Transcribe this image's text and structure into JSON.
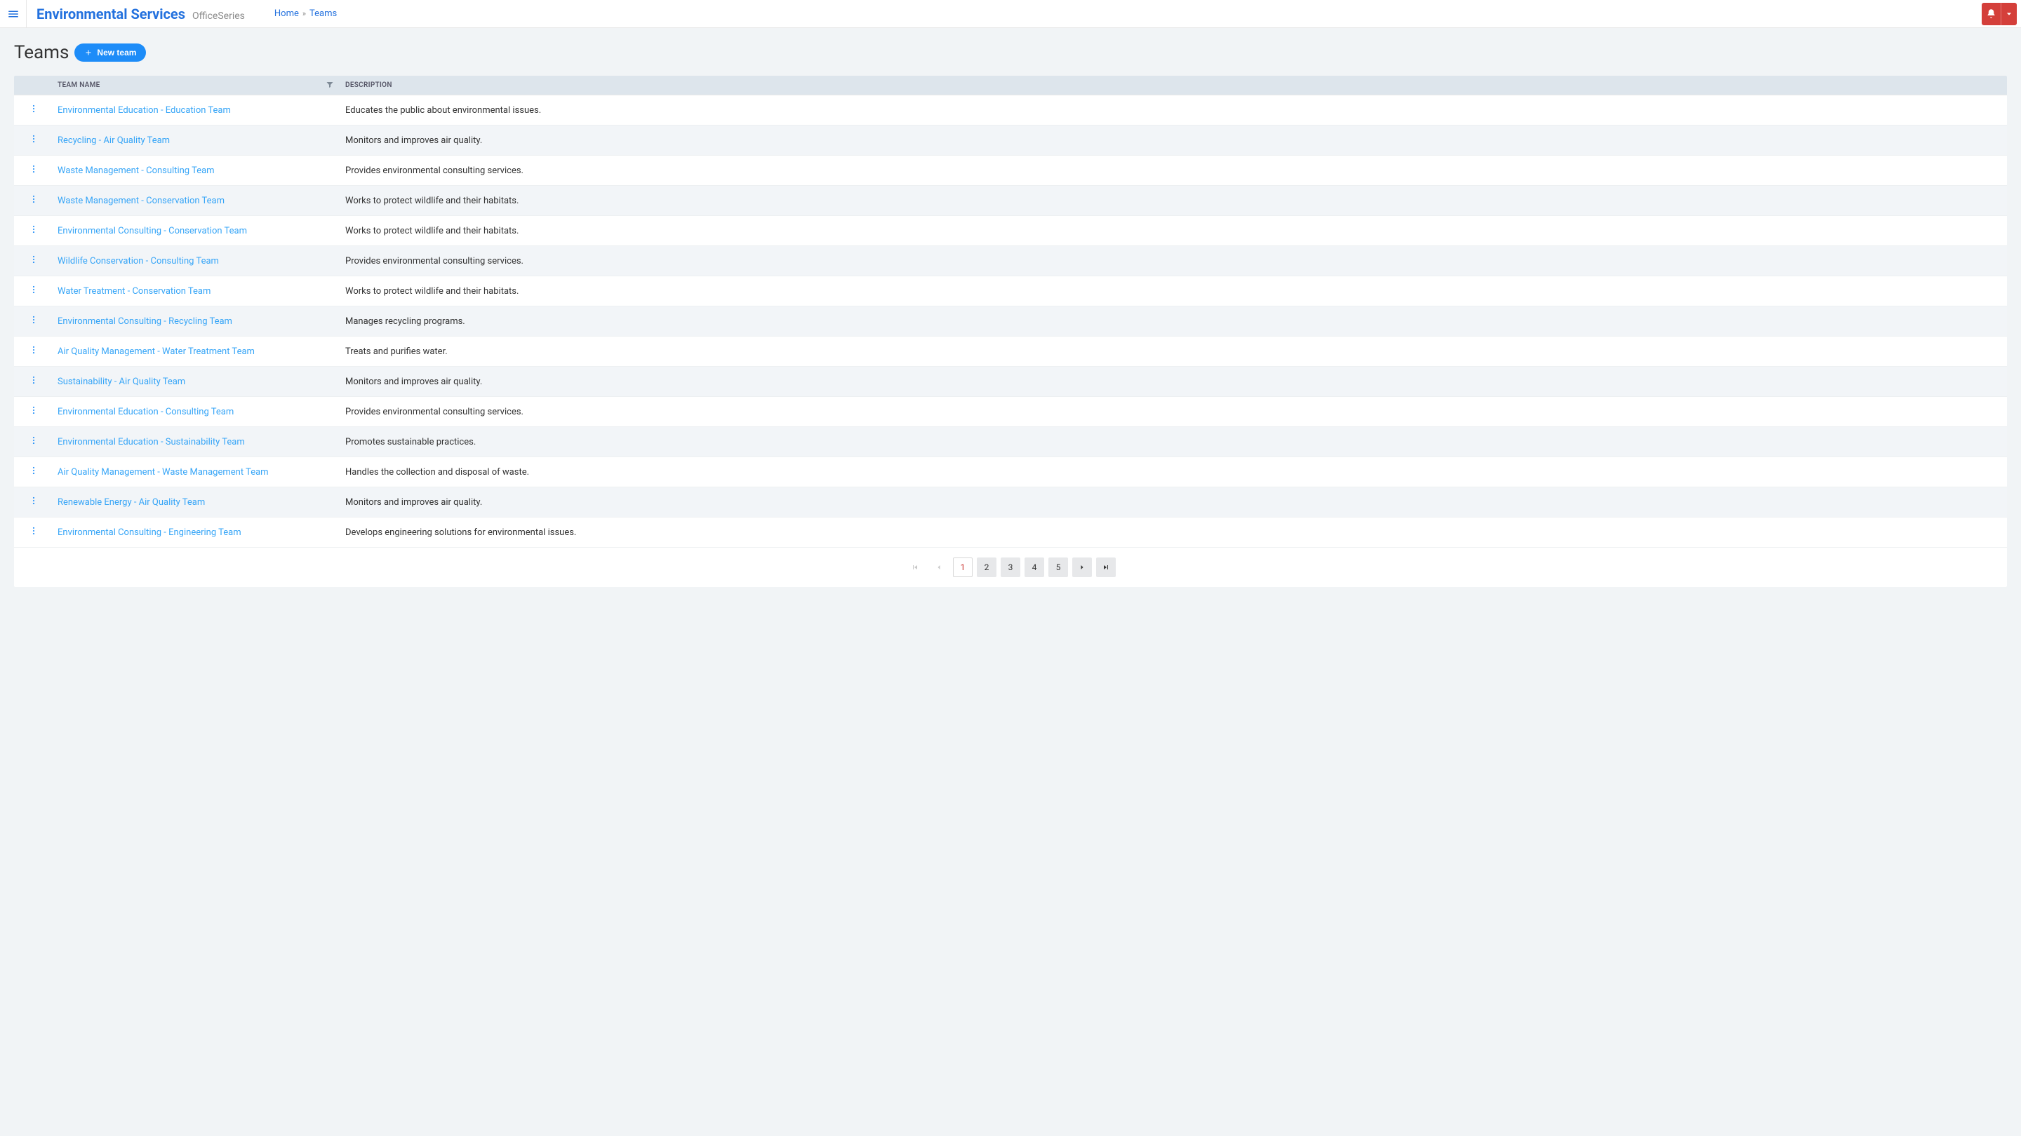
{
  "topbar": {
    "brand_title": "Environmental Services",
    "brand_subtitle": "OfficeSeries"
  },
  "breadcrumb": {
    "home": "Home",
    "current": "Teams"
  },
  "page": {
    "title": "Teams",
    "new_button": "New team"
  },
  "table": {
    "headers": {
      "name": "TEAM NAME",
      "description": "DESCRIPTION"
    },
    "rows": [
      {
        "name": "Environmental Education - Education Team",
        "description": "Educates the public about environmental issues."
      },
      {
        "name": "Recycling - Air Quality Team",
        "description": "Monitors and improves air quality."
      },
      {
        "name": "Waste Management - Consulting Team",
        "description": "Provides environmental consulting services."
      },
      {
        "name": "Waste Management - Conservation Team",
        "description": "Works to protect wildlife and their habitats."
      },
      {
        "name": "Environmental Consulting - Conservation Team",
        "description": "Works to protect wildlife and their habitats."
      },
      {
        "name": "Wildlife Conservation - Consulting Team",
        "description": "Provides environmental consulting services."
      },
      {
        "name": "Water Treatment - Conservation Team",
        "description": "Works to protect wildlife and their habitats."
      },
      {
        "name": "Environmental Consulting - Recycling Team",
        "description": "Manages recycling programs."
      },
      {
        "name": "Air Quality Management - Water Treatment Team",
        "description": "Treats and purifies water."
      },
      {
        "name": "Sustainability - Air Quality Team",
        "description": "Monitors and improves air quality."
      },
      {
        "name": "Environmental Education - Consulting Team",
        "description": "Provides environmental consulting services."
      },
      {
        "name": "Environmental Education - Sustainability Team",
        "description": "Promotes sustainable practices."
      },
      {
        "name": "Air Quality Management - Waste Management Team",
        "description": "Handles the collection and disposal of waste."
      },
      {
        "name": "Renewable Energy - Air Quality Team",
        "description": "Monitors and improves air quality."
      },
      {
        "name": "Environmental Consulting - Engineering Team",
        "description": "Develops engineering solutions for environmental issues."
      }
    ]
  },
  "pagination": {
    "pages": [
      "1",
      "2",
      "3",
      "4",
      "5"
    ],
    "current": "1"
  }
}
